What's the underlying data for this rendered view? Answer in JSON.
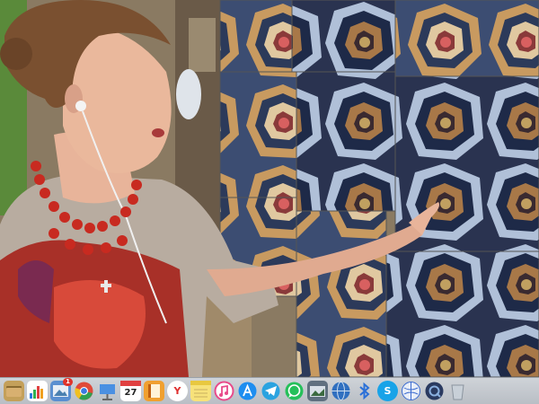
{
  "video": {
    "scene": "video-call-quilt-presentation"
  },
  "dock": {
    "items": [
      {
        "name": "finder-folder-icon",
        "color": "#c4a05a"
      },
      {
        "name": "activity-chart-icon",
        "color": "#3b8fe0"
      },
      {
        "name": "photos-preview-icon",
        "color": "#5a8fd0",
        "badge": "1"
      },
      {
        "name": "chrome-icon",
        "color": "#e04a3a"
      },
      {
        "name": "presentation-icon",
        "color": "#4a90e2"
      },
      {
        "name": "calendar-icon",
        "color": "#ffffff",
        "text": "27"
      },
      {
        "name": "books-icon",
        "color": "#f0a030"
      },
      {
        "name": "yandex-browser-icon",
        "color": "#e03030",
        "text": "Y"
      },
      {
        "name": "notes-icon",
        "color": "#f7e27a"
      },
      {
        "name": "itunes-icon",
        "color": "#e84b8a"
      },
      {
        "name": "app-store-icon",
        "color": "#1e8ef0"
      },
      {
        "name": "telegram-icon",
        "color": "#2aa3e0"
      },
      {
        "name": "whatsapp-icon",
        "color": "#25c05a"
      },
      {
        "name": "image-capture-icon",
        "color": "#607080"
      },
      {
        "name": "globe-network-icon",
        "color": "#3070c0"
      },
      {
        "name": "bluetooth-icon",
        "color": "#2a70d8"
      },
      {
        "name": "skype-icon",
        "color": "#18a3e8",
        "text": "S"
      },
      {
        "name": "dictionary-globe-icon",
        "color": "#3a6ad0"
      },
      {
        "name": "quicktime-icon",
        "color": "#2a3a60"
      },
      {
        "name": "trash-icon",
        "color": "#9aa4ae"
      }
    ]
  }
}
